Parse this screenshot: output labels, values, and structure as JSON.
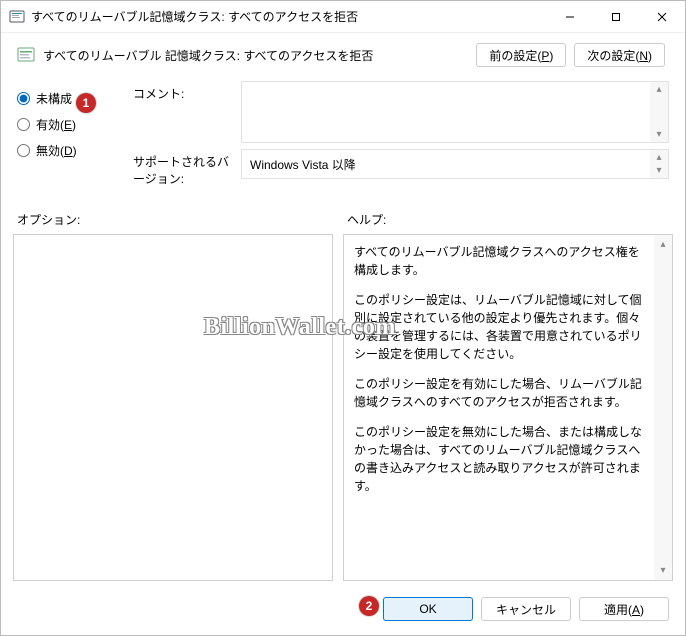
{
  "window": {
    "title": "すべてのリムーバブル記憶域クラス: すべてのアクセスを拒否"
  },
  "header": {
    "title": "すべてのリムーバブル 記憶域クラス: すべてのアクセスを拒否",
    "prev": "前の設定(P)",
    "next": "次の設定(N)"
  },
  "state": {
    "options": {
      "not_configured": "未構成",
      "enabled": "有効(E)",
      "disabled": "無効(D)"
    },
    "selected": "not_configured"
  },
  "fields": {
    "comment_label": "コメント:",
    "comment_value": "",
    "supported_label": "サポートされるバージョン:",
    "supported_value": "Windows Vista 以降"
  },
  "sections": {
    "options_label": "オプション:",
    "help_label": "ヘルプ:"
  },
  "help": {
    "p1": "すべてのリムーバブル記憶域クラスへのアクセス権を構成します。",
    "p2": "このポリシー設定は、リムーバブル記憶域に対して個別に設定されている他の設定より優先されます。個々の装置を管理するには、各装置で用意されているポリシー設定を使用してください。",
    "p3": "このポリシー設定を有効にした場合、リムーバブル記憶域クラスへのすべてのアクセスが拒否されます。",
    "p4": "このポリシー設定を無効にした場合、または構成しなかった場合は、すべてのリムーバブル記憶域クラスへの書き込みアクセスと読み取りアクセスが許可されます。"
  },
  "footer": {
    "ok": "OK",
    "cancel": "キャンセル",
    "apply": "適用(A)"
  },
  "markers": {
    "m1": "1",
    "m2": "2"
  },
  "watermark": "BillionWallet.com"
}
